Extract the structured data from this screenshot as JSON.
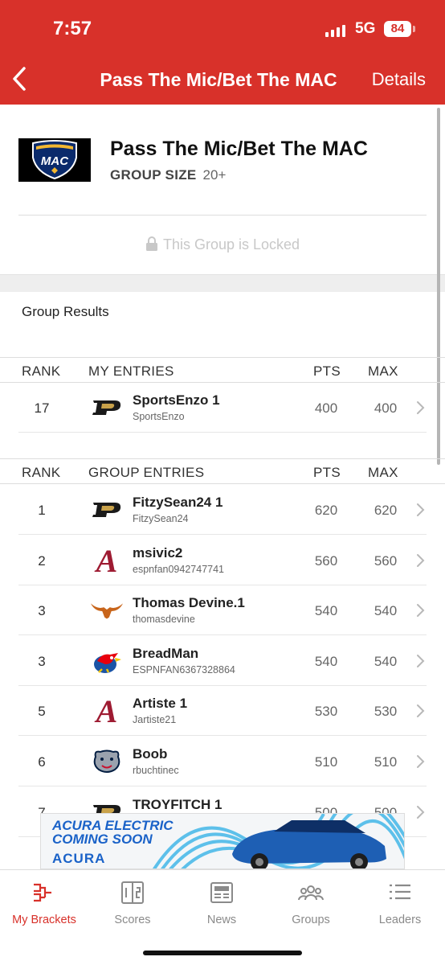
{
  "status_bar": {
    "time": "7:57",
    "network": "5G",
    "battery": "84"
  },
  "nav": {
    "title": "Pass The Mic/Bet The MAC",
    "details_label": "Details"
  },
  "group": {
    "logo_text": "MAC",
    "title": "Pass The Mic/Bet The MAC",
    "size_label": "GROUP SIZE",
    "size_value": "20+",
    "locked_text": "This Group is Locked"
  },
  "results_label": "Group Results",
  "my_entries": {
    "headers": {
      "rank": "RANK",
      "name": "MY ENTRIES",
      "pts": "PTS",
      "max": "MAX"
    },
    "rows": [
      {
        "rank": "17",
        "entry": "SportsEnzo 1",
        "user": "SportsEnzo",
        "pts": "400",
        "max": "400",
        "team": "purdue"
      }
    ]
  },
  "group_entries": {
    "headers": {
      "rank": "RANK",
      "name": "GROUP ENTRIES",
      "pts": "PTS",
      "max": "MAX"
    },
    "rows": [
      {
        "rank": "1",
        "entry": "FitzySean24 1",
        "user": "FitzySean24",
        "pts": "620",
        "max": "620",
        "team": "purdue"
      },
      {
        "rank": "2",
        "entry": "msivic2",
        "user": "espnfan0942747741",
        "pts": "560",
        "max": "560",
        "team": "alabama"
      },
      {
        "rank": "3",
        "entry": "Thomas Devine.1",
        "user": "thomasdevine",
        "pts": "540",
        "max": "540",
        "team": "texas"
      },
      {
        "rank": "3",
        "entry": "BreadMan",
        "user": "ESPNFAN6367328864",
        "pts": "540",
        "max": "540",
        "team": "kansas"
      },
      {
        "rank": "5",
        "entry": "Artiste 1",
        "user": "Jartiste21",
        "pts": "530",
        "max": "530",
        "team": "alabama"
      },
      {
        "rank": "6",
        "entry": "Boob",
        "user": "rbuchtinec",
        "pts": "510",
        "max": "510",
        "team": "gonzaga"
      },
      {
        "rank": "7",
        "entry": "TROYFITCH 1",
        "user": "",
        "pts": "500",
        "max": "500",
        "team": "purdue"
      }
    ]
  },
  "ad": {
    "line1": "ACURA ELECTRIC",
    "line2": "COMING SOON",
    "brand": "ACURA"
  },
  "tabs": [
    {
      "label": "My Brackets",
      "icon": "bracket-icon",
      "active": true
    },
    {
      "label": "Scores",
      "icon": "scoreboard-icon",
      "active": false
    },
    {
      "label": "News",
      "icon": "news-icon",
      "active": false
    },
    {
      "label": "Groups",
      "icon": "groups-icon",
      "active": false
    },
    {
      "label": "Leaders",
      "icon": "leaders-icon",
      "active": false
    }
  ],
  "colors": {
    "brand_red": "#d8312a",
    "inactive_tab": "#8a8a8a"
  }
}
